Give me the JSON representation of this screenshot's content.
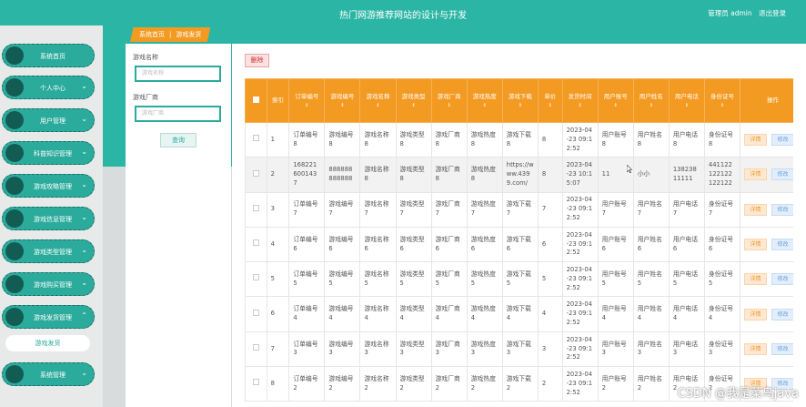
{
  "header": {
    "title": "热门网游推荐网站的设计与开发",
    "user_label": "管理员 admin",
    "logout": "退出登录"
  },
  "sidebar": {
    "items": [
      {
        "label": "系统首页",
        "has_chevron": false
      },
      {
        "label": "个人中心",
        "has_chevron": true
      },
      {
        "label": "用户管理",
        "has_chevron": true
      },
      {
        "label": "科普知识管理",
        "has_chevron": true
      },
      {
        "label": "游戏攻略管理",
        "has_chevron": true
      },
      {
        "label": "游戏信息管理",
        "has_chevron": true
      },
      {
        "label": "游戏类型管理",
        "has_chevron": true
      },
      {
        "label": "游戏购买管理",
        "has_chevron": true
      },
      {
        "label": "游戏发货管理",
        "has_chevron": true,
        "expanded": true
      },
      {
        "label": "系统管理",
        "has_chevron": true
      }
    ],
    "submenu": "游戏发货"
  },
  "breadcrumb": {
    "home": "系统首页",
    "sep": "|",
    "current": "游戏发货"
  },
  "search": {
    "name_label": "游戏名称",
    "name_placeholder": "游戏名称",
    "vendor_label": "游戏厂商",
    "vendor_placeholder": "游戏厂商",
    "query_button": "查询"
  },
  "toolbar": {
    "delete_label": "删除"
  },
  "table": {
    "headers": [
      "索引",
      "订单编号",
      "游戏编号",
      "游戏名称",
      "游戏类型",
      "游戏厂商",
      "游戏热度",
      "游戏下载",
      "单价",
      "发货时间",
      "用户账号",
      "用户姓名",
      "用户电话",
      "身份证号",
      "操作"
    ],
    "sort_arrow": "⇕",
    "detail_label": "详情",
    "edit_label": "修改",
    "rows": [
      [
        "1",
        "订单编号8",
        "游戏编号8",
        "游戏名称8",
        "游戏类型8",
        "游戏厂商8",
        "游戏热度8",
        "游戏下载8",
        "8",
        "2023-04-23 09:12:52",
        "用户账号8",
        "用户姓名8",
        "用户电话8",
        "身份证号8"
      ],
      [
        "2",
        "1682216001437",
        "888888888888",
        "游戏名称8",
        "游戏类型8",
        "游戏厂商8",
        "游戏热度8",
        "https://www.4399.com/",
        "8",
        "2023-04-23 10:15:07",
        "11",
        "小小",
        "13823811111",
        "441122122122122122"
      ],
      [
        "3",
        "订单编号7",
        "游戏编号7",
        "游戏名称7",
        "游戏类型7",
        "游戏厂商7",
        "游戏热度7",
        "游戏下载7",
        "7",
        "2023-04-23 09:12:52",
        "用户账号7",
        "用户姓名7",
        "用户电话7",
        "身份证号7"
      ],
      [
        "4",
        "订单编号6",
        "游戏编号6",
        "游戏名称6",
        "游戏类型6",
        "游戏厂商6",
        "游戏热度6",
        "游戏下载6",
        "6",
        "2023-04-23 09:12:52",
        "用户账号6",
        "用户姓名6",
        "用户电话6",
        "身份证号6"
      ],
      [
        "5",
        "订单编号5",
        "游戏编号5",
        "游戏名称5",
        "游戏类型5",
        "游戏厂商5",
        "游戏热度5",
        "游戏下载5",
        "5",
        "2023-04-23 09:12:52",
        "用户账号5",
        "用户姓名5",
        "用户电话5",
        "身份证号5"
      ],
      [
        "6",
        "订单编号4",
        "游戏编号4",
        "游戏名称4",
        "游戏类型4",
        "游戏厂商4",
        "游戏热度4",
        "游戏下载4",
        "4",
        "2023-04-23 09:12:52",
        "用户账号4",
        "用户姓名4",
        "用户电话4",
        "身份证号4"
      ],
      [
        "7",
        "订单编号3",
        "游戏编号3",
        "游戏名称3",
        "游戏类型3",
        "游戏厂商3",
        "游戏热度3",
        "游戏下载3",
        "3",
        "2023-04-23 09:12:52",
        "用户账号3",
        "用户姓名3",
        "用户电话3",
        "身份证号3"
      ],
      [
        "8",
        "订单编号2",
        "游戏编号2",
        "游戏名称2",
        "游戏类型2",
        "游戏厂商2",
        "游戏热度2",
        "游戏下载2",
        "2",
        "2023-04-23 09:12:52",
        "用户账号2",
        "用户姓名2",
        "用户电话2",
        "身份证号2"
      ]
    ]
  },
  "watermark": "CSDN @我是菜鸟java"
}
